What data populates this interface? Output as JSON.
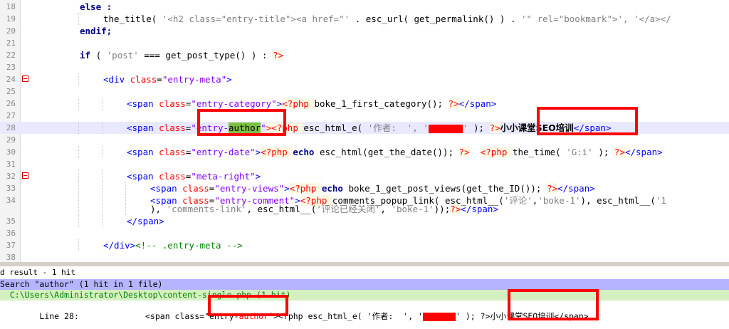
{
  "editor": {
    "lines": [
      {
        "num": "18",
        "parts": [
          {
            "t": "else :",
            "c": "kw"
          }
        ]
      },
      {
        "num": "19",
        "parts": [
          {
            "t": "the_title( ",
            "c": "fn"
          },
          {
            "t": "'<h2 class=\"entry-title\"><a href=\"' ",
            "c": "str"
          },
          {
            "t": ". esc_url( get_permalink() ) . ",
            "c": "fn"
          },
          {
            "t": "'\" rel=\"bookmark\">', '</a></",
            "c": "str"
          }
        ]
      },
      {
        "num": "20",
        "parts": [
          {
            "t": "endif;",
            "c": "kw"
          }
        ]
      },
      {
        "num": "21",
        "parts": []
      },
      {
        "num": "22",
        "parts": [
          {
            "t": "if ",
            "c": "kw"
          },
          {
            "t": "( ",
            "c": "fn"
          },
          {
            "t": "'post' ",
            "c": "str"
          },
          {
            "t": "=== get_post_type() ) : ",
            "c": "fn"
          },
          {
            "t": "?>",
            "c": "php"
          }
        ]
      },
      {
        "num": "23",
        "parts": []
      },
      {
        "num": "24",
        "parts": [
          {
            "t": "<div ",
            "c": "tag"
          },
          {
            "t": "class",
            "c": "attr"
          },
          {
            "t": "=",
            "c": "plain"
          },
          {
            "t": "\"entry-meta\"",
            "c": "aval"
          },
          {
            "t": ">",
            "c": "tag"
          }
        ]
      },
      {
        "num": "25",
        "parts": []
      },
      {
        "num": "26",
        "parts": [
          {
            "t": "<span ",
            "c": "tag"
          },
          {
            "t": "class",
            "c": "attr"
          },
          {
            "t": "=",
            "c": "plain"
          },
          {
            "t": "\"entry-category\"",
            "c": "aval"
          },
          {
            "t": ">",
            "c": "tag"
          },
          {
            "t": "<?php ",
            "c": "php"
          },
          {
            "t": "boke_1_first_category(); ",
            "c": "fn"
          },
          {
            "t": "?>",
            "c": "php"
          },
          {
            "t": "</span>",
            "c": "tag"
          }
        ]
      },
      {
        "num": "27",
        "parts": []
      },
      {
        "num": "28",
        "parts": [
          {
            "t": "<span ",
            "c": "tag"
          },
          {
            "t": "class",
            "c": "attr"
          },
          {
            "t": "=",
            "c": "plain"
          },
          {
            "t": "\"entry-",
            "c": "aval"
          },
          {
            "t": "author",
            "c": "mark"
          },
          {
            "t": "\"",
            "c": "aval"
          },
          {
            "t": "><?php ",
            "c": "php"
          },
          {
            "t": "esc_html_e( ",
            "c": "fn"
          },
          {
            "t": "'作者:  ', '",
            "c": "str"
          },
          {
            "t": "REDACTED",
            "c": "redact"
          },
          {
            "t": "' ",
            "c": "str"
          },
          {
            "t": "); ",
            "c": "fn"
          },
          {
            "t": "?>",
            "c": "php"
          },
          {
            "t": "小小课堂SEO培训",
            "c": "boldtxt"
          },
          {
            "t": "</span>",
            "c": "tag"
          }
        ]
      },
      {
        "num": "29",
        "parts": []
      },
      {
        "num": "30",
        "parts": [
          {
            "t": "<span ",
            "c": "tag"
          },
          {
            "t": "class",
            "c": "attr"
          },
          {
            "t": "=",
            "c": "plain"
          },
          {
            "t": "\"entry-date\"",
            "c": "aval"
          },
          {
            "t": ">",
            "c": "tag"
          },
          {
            "t": "<?php ",
            "c": "php"
          },
          {
            "t": "echo ",
            "c": "kw"
          },
          {
            "t": "esc_html(get_the_date()); ",
            "c": "fn"
          },
          {
            "t": "?>",
            "c": "php"
          },
          {
            "t": "  ",
            "c": "plain"
          },
          {
            "t": "<?php ",
            "c": "php"
          },
          {
            "t": "the_time( ",
            "c": "fn"
          },
          {
            "t": "'G:i' ",
            "c": "str"
          },
          {
            "t": "); ",
            "c": "fn"
          },
          {
            "t": "?>",
            "c": "php"
          },
          {
            "t": "</span>",
            "c": "tag"
          }
        ]
      },
      {
        "num": "31",
        "parts": []
      },
      {
        "num": "32",
        "parts": [
          {
            "t": "<span ",
            "c": "tag"
          },
          {
            "t": "class",
            "c": "attr"
          },
          {
            "t": "=",
            "c": "plain"
          },
          {
            "t": "\"meta-right\"",
            "c": "aval"
          },
          {
            "t": ">",
            "c": "tag"
          }
        ]
      },
      {
        "num": "33",
        "parts": [
          {
            "t": "<span ",
            "c": "tag"
          },
          {
            "t": "class",
            "c": "attr"
          },
          {
            "t": "=",
            "c": "plain"
          },
          {
            "t": "\"entry-views\"",
            "c": "aval"
          },
          {
            "t": ">",
            "c": "tag"
          },
          {
            "t": "<?php ",
            "c": "php"
          },
          {
            "t": "echo ",
            "c": "kw"
          },
          {
            "t": "boke_1_get_post_views(get_the_ID()); ",
            "c": "fn"
          },
          {
            "t": "?>",
            "c": "php"
          },
          {
            "t": "</span>",
            "c": "tag"
          }
        ]
      },
      {
        "num": "34",
        "parts": [
          {
            "t": "<span ",
            "c": "tag"
          },
          {
            "t": "class",
            "c": "attr"
          },
          {
            "t": "=",
            "c": "plain"
          },
          {
            "t": "\"entry-comment\"",
            "c": "aval"
          },
          {
            "t": ">",
            "c": "tag"
          },
          {
            "t": "<?php ",
            "c": "php"
          },
          {
            "t": "comments_popup_link( esc_html__(",
            "c": "fn"
          },
          {
            "t": "'评论'",
            "c": "str"
          },
          {
            "t": ",",
            "c": "fn"
          },
          {
            "t": "'boke-1'",
            "c": "str"
          },
          {
            "t": "), esc_html__(",
            "c": "fn"
          },
          {
            "t": "'1",
            "c": "str"
          }
        ]
      },
      {
        "num": "",
        "parts": [
          {
            "t": "), ",
            "c": "fn"
          },
          {
            "t": "'comments-link'",
            "c": "str"
          },
          {
            "t": ", esc_html__(",
            "c": "fn"
          },
          {
            "t": "'评论已经关闭'",
            "c": "str"
          },
          {
            "t": ", ",
            "c": "fn"
          },
          {
            "t": "'boke-1'",
            "c": "str"
          },
          {
            "t": "));",
            "c": "fn"
          },
          {
            "t": "?>",
            "c": "php"
          },
          {
            "t": "</span>",
            "c": "tag"
          }
        ]
      },
      {
        "num": "35",
        "parts": [
          {
            "t": "</span>",
            "c": "tag"
          }
        ]
      },
      {
        "num": "36",
        "parts": []
      },
      {
        "num": "37",
        "parts": [
          {
            "t": "</div>",
            "c": "tag"
          },
          {
            "t": "<!-- .entry-meta -->",
            "c": "cmt"
          }
        ]
      },
      {
        "num": "38",
        "parts": []
      }
    ]
  },
  "results": {
    "title": "d result - 1 hit",
    "search_line": "Search \"author\" (1 hit in 1 file)",
    "file_line": "  C:\\Users\\Administrator\\Desktop\\content-single.php (1 hit)",
    "hit_line_label": "    Line 28:",
    "hit_parts": [
      {
        "t": "<span class=",
        "c": "plain"
      },
      {
        "t": "\"entry-",
        "c": "plain"
      },
      {
        "t": "author",
        "c": "attr"
      },
      {
        "t": "\"",
        "c": "plain"
      },
      {
        "t": "><?php esc_html_e( '作者:  ', '",
        "c": "plain"
      },
      {
        "t": "REDACTED",
        "c": "redact"
      },
      {
        "t": "' ); ?>",
        "c": "plain"
      },
      {
        "t": "小小课堂SEO培训",
        "c": "plain"
      },
      {
        "t": "</span>",
        "c": "plain"
      }
    ]
  }
}
